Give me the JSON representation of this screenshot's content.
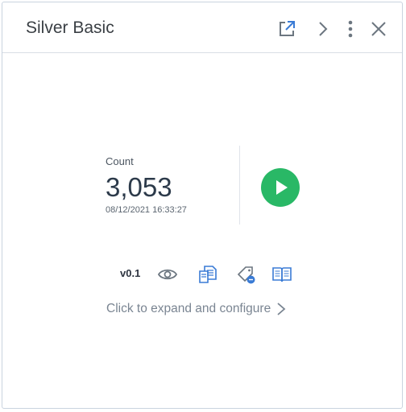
{
  "widget": {
    "title": "Silver Basic"
  },
  "header_icons": {
    "external": "external-link-icon",
    "next": "chevron-right-icon",
    "more": "more-vertical-icon",
    "close": "close-icon"
  },
  "metric": {
    "label": "Count",
    "value": "3,053",
    "timestamp": "08/12/2021 16:33:27"
  },
  "footer": {
    "version": "v0.1",
    "expand_text": "Click to expand and configure"
  },
  "colors": {
    "accent_green": "#29b866",
    "icon_blue": "#3a7bd5",
    "icon_gray": "#6c7680"
  }
}
